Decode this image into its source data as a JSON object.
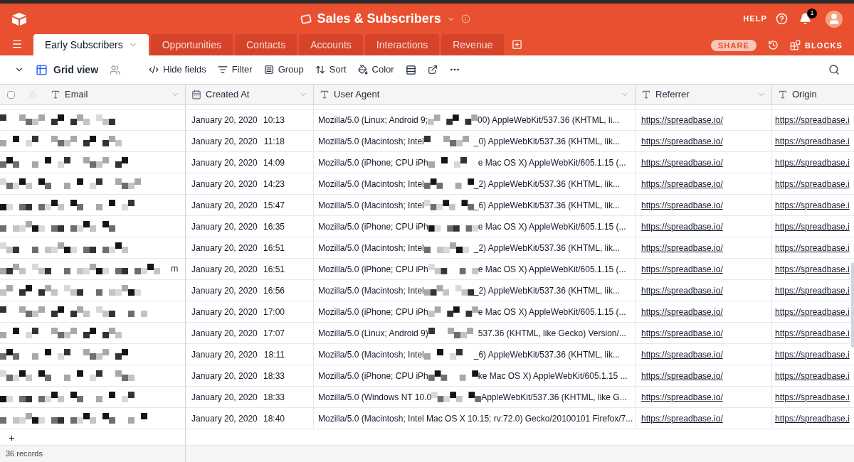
{
  "base": {
    "title": "Sales & Subscribers"
  },
  "header_right": {
    "help": "HELP",
    "notifications": "1",
    "share": "SHARE",
    "blocks": "BLOCKS"
  },
  "tabs": [
    {
      "label": "Early Subscribers",
      "selected": true
    },
    {
      "label": "Opportunities",
      "selected": false
    },
    {
      "label": "Contacts",
      "selected": false
    },
    {
      "label": "Accounts",
      "selected": false
    },
    {
      "label": "Interactions",
      "selected": false
    },
    {
      "label": "Revenue",
      "selected": false
    }
  ],
  "view": {
    "name": "Grid view"
  },
  "select_all": {
    "checked": false
  },
  "toolbar": [
    "Hide fields",
    "Filter",
    "Group",
    "Sort",
    "Color"
  ],
  "table": {
    "columns": [
      {
        "label": "Email",
        "kind": "text"
      },
      {
        "label": "Created At",
        "kind": "date"
      },
      {
        "label": "User Agent",
        "kind": "text"
      },
      {
        "label": "Referrer",
        "kind": "text"
      },
      {
        "label": "Origin",
        "kind": "text"
      }
    ],
    "rows": [
      {
        "date": "January 20, 2020",
        "time": "10:13",
        "agent_start": "Mozilla/5.0 (Linux; Android 9;",
        "agent_end": "00) AppleWebKit/537.36 (KHTML, li...",
        "referrer": "https://spreadbase.io/",
        "origin": "https://spreadbase.i"
      },
      {
        "date": "January 20, 2020",
        "time": "11:18",
        "agent_start": "Mozilla/5.0 (Macintosh; Intel",
        "agent_end": "_0) AppleWebKit/537.36 (KHTML, lik...",
        "referrer": "https://spreadbase.io/",
        "origin": "https://spreadbase.i"
      },
      {
        "date": "January 20, 2020",
        "time": "14:09",
        "agent_start": "Mozilla/5.0 (iPhone; CPU iPh",
        "agent_end": "e Mac OS X) AppleWebKit/605.1.15 (...",
        "referrer": "https://spreadbase.io/",
        "origin": "https://spreadbase.i"
      },
      {
        "date": "January 20, 2020",
        "time": "14:23",
        "agent_start": "Mozilla/5.0 (Macintosh; Intel",
        "agent_end": "_2) AppleWebKit/537.36 (KHTML, lik...",
        "referrer": "https://spreadbase.io/",
        "origin": "https://spreadbase.i"
      },
      {
        "date": "January 20, 2020",
        "time": "15:47",
        "agent_start": "Mozilla/5.0 (Macintosh; Intel",
        "agent_end": "_6) AppleWebKit/537.36 (KHTML, lik...",
        "referrer": "https://spreadbase.io/",
        "origin": "https://spreadbase.i"
      },
      {
        "date": "January 20, 2020",
        "time": "16:35",
        "agent_start": "Mozilla/5.0 (iPhone; CPU iPh",
        "agent_end": "e Mac OS X) AppleWebKit/605.1.15 (...",
        "referrer": "https://spreadbase.io/",
        "origin": "https://spreadbase.i"
      },
      {
        "date": "January 20, 2020",
        "time": "16:51",
        "agent_start": "Mozilla/5.0 (Macintosh; Intel",
        "agent_end": "_2) AppleWebKit/537.36 (KHTML, lik...",
        "referrer": "https://spreadbase.io/",
        "origin": "https://spreadbase.i"
      },
      {
        "date": "January 20, 2020",
        "time": "16:51",
        "email_tail": "m",
        "agent_start": "Mozilla/5.0 (iPhone; CPU iPh",
        "agent_end": "e Mac OS X) AppleWebKit/605.1.15 (...",
        "referrer": "https://spreadbase.io/",
        "origin": "https://spreadbase.i"
      },
      {
        "date": "January 20, 2020",
        "time": "16:56",
        "agent_start": "Mozilla/5.0 (Macintosh; Intel",
        "agent_end": "_2) AppleWebKit/537.36 (KHTML, lik...",
        "referrer": "https://spreadbase.io/",
        "origin": "https://spreadbase.i"
      },
      {
        "date": "January 20, 2020",
        "time": "17:00",
        "agent_start": "Mozilla/5.0 (iPhone; CPU iPh",
        "agent_end": "e Mac OS X) AppleWebKit/605.1.15 (...",
        "referrer": "https://spreadbase.io/",
        "origin": "https://spreadbase.i"
      },
      {
        "date": "January 20, 2020",
        "time": "17:07",
        "agent_start": "Mozilla/5.0 (Linux; Android 9)",
        "agent_end": "537.36 (KHTML, like Gecko) Version/...",
        "referrer": "https://spreadbase.io/",
        "origin": "https://spreadbase.i"
      },
      {
        "date": "January 20, 2020",
        "time": "18:11",
        "agent_start": "Mozilla/5.0 (Macintosh; Intel",
        "agent_end": "_6) AppleWebKit/537.36 (KHTML, lik...",
        "referrer": "https://spreadbase.io/",
        "origin": "https://spreadbase.i"
      },
      {
        "date": "January 20, 2020",
        "time": "18:33",
        "agent_start": "Mozilla/5.0 (iPhone; CPU iPh",
        "agent_end": "ke Mac OS X) AppleWebKit/605.1.15 ...",
        "referrer": "https://spreadbase.io/",
        "origin": "https://spreadbase.i"
      },
      {
        "date": "January 20, 2020",
        "time": "18:33",
        "agent_start": "Mozilla/5.0 (Windows NT 10.0",
        "agent_end": "AppleWebKit/537.36 (KHTML, like G...",
        "referrer": "https://spreadbase.io/",
        "origin": "https://spreadbase.i"
      },
      {
        "date": "January 20, 2020",
        "time": "18:40",
        "agent_start": "Mozilla/5.0 (Macintosh; Intel Mac OS X 10.15; rv:72.0) Gecko/20100101 Firefox/7...",
        "referrer": "https://spreadbase.io/",
        "origin": "https://spreadbase.i"
      }
    ]
  },
  "add_row": "+",
  "footer": {
    "records": "36 records"
  }
}
